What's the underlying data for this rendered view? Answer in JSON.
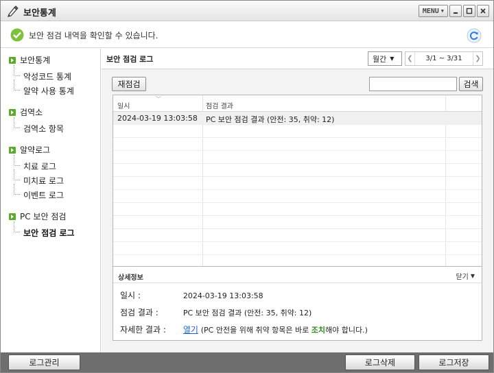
{
  "window": {
    "title": "보안통계",
    "menu_label": "MENU"
  },
  "notice": {
    "message": "보안 점검 내역을 확인할 수 있습니다."
  },
  "sidebar": {
    "groups": [
      {
        "label": "보안통계",
        "items": [
          "악성코드 통계",
          "알약 사용 통계"
        ]
      },
      {
        "label": "검역소",
        "items": [
          "검역소 항목"
        ]
      },
      {
        "label": "알약로그",
        "items": [
          "치료 로그",
          "미치료 로그",
          "이벤트 로그"
        ]
      },
      {
        "label": "PC 보안 점검",
        "items": [
          "보안 점검 로그"
        ]
      }
    ]
  },
  "main": {
    "title": "보안 점검 로그",
    "period_select": "월간",
    "date_range": "3/1 ~ 3/31",
    "recheck_button": "재점검",
    "search_input_value": "",
    "search_button": "검색",
    "table": {
      "columns": [
        "일시",
        "점검 결과"
      ],
      "rows": [
        [
          "2024-03-19 13:03:58",
          "PC 보안 점검 결과 (안전: 35, 취약: 12)"
        ]
      ]
    },
    "detail": {
      "title": "상세정보",
      "close_label": "닫기",
      "datetime_label": "일시 :",
      "datetime_value": "2024-03-19 13:03:58",
      "result_label": "점검 결과 :",
      "result_value": "PC 보안 점검 결과 (안전: 35, 취약: 12)",
      "detail_label": "자세한 결과 :",
      "open_link": "열기",
      "note_prefix": "(PC 안전을 위해 취약 항목은 바로 ",
      "note_highlight": "조치",
      "note_suffix": "해야 합니다.)"
    }
  },
  "footer": {
    "log_manage": "로그관리",
    "log_delete": "로그삭제",
    "log_save": "로그저장"
  },
  "colors": {
    "accent_green": "#5aaa2e",
    "link_blue": "#1a63c8",
    "bottom_bar": "#6e6e6e"
  }
}
